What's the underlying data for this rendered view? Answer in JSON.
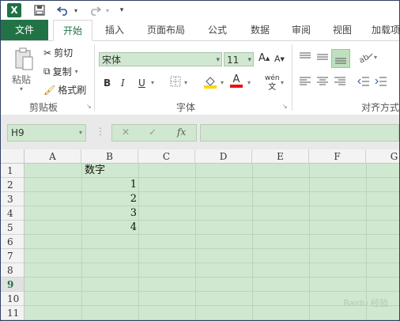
{
  "qat": {
    "app_icon": "X"
  },
  "tabs": [
    {
      "label": "文件"
    },
    {
      "label": "开始"
    },
    {
      "label": "插入"
    },
    {
      "label": "页面布局"
    },
    {
      "label": "公式"
    },
    {
      "label": "数据"
    },
    {
      "label": "审阅"
    },
    {
      "label": "视图"
    },
    {
      "label": "加载项"
    }
  ],
  "ribbon": {
    "clipboard": {
      "paste": "粘贴",
      "cut": "剪切",
      "copy": "复制",
      "format_painter": "格式刷",
      "group": "剪贴板"
    },
    "font": {
      "name": "宋体",
      "size": "11",
      "bold": "B",
      "italic": "I",
      "underline": "U",
      "group": "字体",
      "phonetic": "wén"
    },
    "alignment": {
      "group": "对齐方式"
    }
  },
  "formula_bar": {
    "name_box": "H9",
    "cancel": "✕",
    "enter": "✓",
    "fx": "fx",
    "value": ""
  },
  "sheet": {
    "columns": [
      "A",
      "B",
      "C",
      "D",
      "E",
      "F",
      "G"
    ],
    "rows": [
      "1",
      "2",
      "3",
      "4",
      "5",
      "6",
      "7",
      "8",
      "9",
      "10",
      "11"
    ],
    "selected_row": "9",
    "cells": {
      "B1": "数字",
      "B2": "1",
      "B3": "2",
      "B4": "3",
      "B5": "4"
    }
  },
  "watermark": "Baidu 经验"
}
